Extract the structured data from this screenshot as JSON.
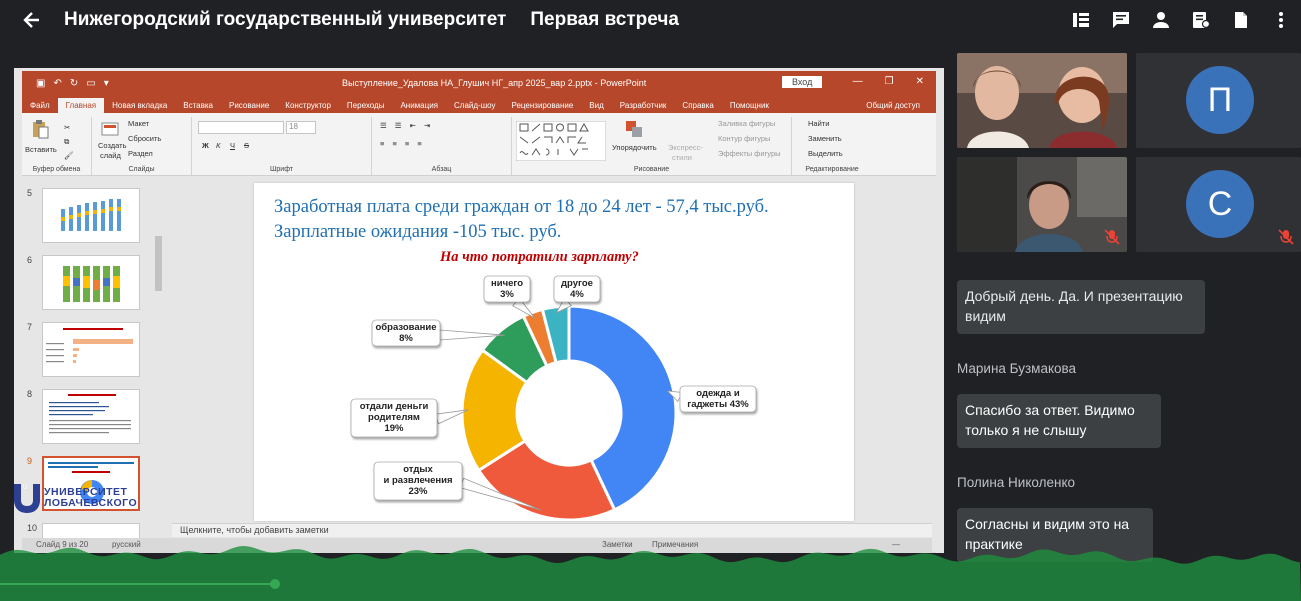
{
  "header": {
    "title": "Нижегородский государственный университет",
    "meeting": "Первая встреча"
  },
  "ppt": {
    "filename": "Выступление_Удалова НА_Глушич НГ_апр 2025_вар 2.pptx  -  PowerPoint",
    "login": "Вход",
    "tabs": [
      "Файл",
      "Главная",
      "Новая вкладка",
      "Вставка",
      "Рисование",
      "Конструктор",
      "Переходы",
      "Анимация",
      "Слайд-шоу",
      "Рецензирование",
      "Вид",
      "Разработчик",
      "Справка",
      "Помощник"
    ],
    "share": "Общий доступ",
    "ribbon": {
      "paste": "Вставить",
      "clipboard": "Буфер обмена",
      "create_slide_1": "Создать",
      "create_slide_2": "слайд",
      "layout": "Макет",
      "reset": "Сбросить",
      "section": "Раздел",
      "slides": "Слайды",
      "font_size": "18",
      "font": "Шрифт",
      "paragraph": "Абзац",
      "arrange": "Упорядочить",
      "express_1": "Экспресс-",
      "express_2": "стили",
      "fill": "Заливка фигуры",
      "outline": "Контур фигуры",
      "effects": "Эффекты фигуры",
      "drawing": "Рисование",
      "find": "Найти",
      "replace": "Заменить",
      "select": "Выделить",
      "editing": "Редактирование",
      "bold": "Ж",
      "italic": "К",
      "underline": "Ч",
      "strike": "S"
    },
    "thumbs": [
      "5",
      "6",
      "7",
      "8",
      "9",
      "10"
    ],
    "notes": "Щелкните, чтобы добавить заметки",
    "status_slide": "Слайд 9 из 20",
    "status_lang": "русский",
    "status_notes": "Заметки",
    "status_comments": "Примечания",
    "status_zoom": "—"
  },
  "slide": {
    "line1": "Заработная плата среди граждан от 18 до 24 лет - 57,4 тыс.руб.",
    "line2": "Зарплатные ожидания -105 тыс. руб."
  },
  "chart_data": {
    "type": "pie",
    "title": "На что потратили зарплату?",
    "categories": [
      "одежда и гаджеты",
      "отдых и развлечения",
      "отдали деньги родителям",
      "образование",
      "ничего",
      "другое"
    ],
    "values": [
      43,
      23,
      19,
      8,
      3,
      4
    ],
    "labels": [
      [
        "одежда и",
        "гаджеты 43%"
      ],
      [
        "отдых",
        "и развлечения",
        "23%"
      ],
      [
        "отдали деньги",
        "родителям",
        "19%"
      ],
      [
        "образование",
        "8%"
      ],
      [
        "ничего",
        "3%"
      ],
      [
        "другое",
        "4%"
      ]
    ],
    "colors": [
      "#4285f4",
      "#ef5a3c",
      "#f4b400",
      "#2e9c5a",
      "#ed7d31",
      "#3bb3c3"
    ],
    "donut": true
  },
  "logo": {
    "line1": "УНИВЕРСИТЕТ",
    "line2": "ЛОБАЧЕВСКОГО",
    "letter": "U"
  },
  "participants": [
    {
      "initial": "П",
      "color": "#3a72b9"
    },
    {
      "initial": "С",
      "color": "#3a72b9"
    }
  ],
  "chat": [
    {
      "sender": "",
      "text": "Добрый день. Да. И презентацию видим"
    },
    {
      "sender": "Марина Бузмакова",
      "text": "Спасибо за ответ. Видимо только я не слышу"
    },
    {
      "sender": "Полина Николенко",
      "text": "Согласны и видим это на практике"
    }
  ]
}
